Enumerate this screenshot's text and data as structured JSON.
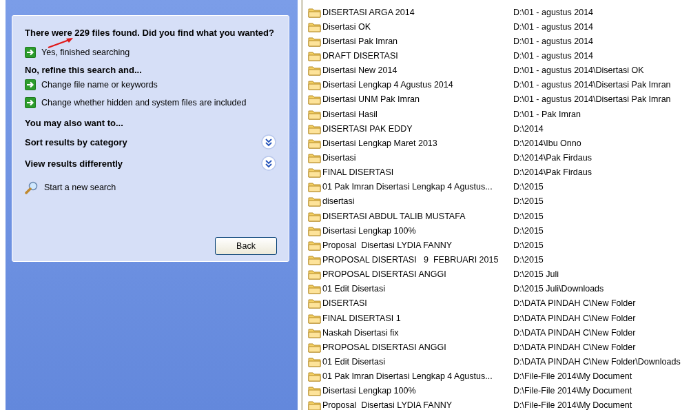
{
  "search_pane": {
    "question": "There were 229 files found. Did you find what you wanted?",
    "finish_link": "Yes, finished searching",
    "refine_heading": "No, refine this search and...",
    "refine_links": [
      "Change file name or keywords",
      "Change whether hidden and system files are included"
    ],
    "also_heading": "You may also want to...",
    "sections": [
      {
        "title": "Sort results by category",
        "expanded": false
      },
      {
        "title": "View results differently",
        "expanded": false
      }
    ],
    "new_search": "Start a new search",
    "back_button": "Back"
  },
  "results": [
    {
      "name": "DISERTASI ARGA 2014",
      "folder": "D:\\01 - agustus 2014"
    },
    {
      "name": "Disertasi OK",
      "folder": "D:\\01 - agustus 2014"
    },
    {
      "name": "Disertasi Pak Imran",
      "folder": "D:\\01 - agustus 2014"
    },
    {
      "name": "DRAFT DISERTASI",
      "folder": "D:\\01 - agustus 2014"
    },
    {
      "name": "Disertasi New 2014",
      "folder": "D:\\01 - agustus 2014\\Disertasi OK"
    },
    {
      "name": "Disertasi Lengkap 4 Agustus 2014",
      "folder": "D:\\01 - agustus 2014\\Disertasi Pak Imran"
    },
    {
      "name": "Disertasi UNM Pak Imran",
      "folder": "D:\\01 - agustus 2014\\Disertasi Pak Imran"
    },
    {
      "name": "Disertasi Hasil",
      "folder": "D:\\01 - Pak Imran"
    },
    {
      "name": "DISERTASI PAK EDDY",
      "folder": "D:\\2014"
    },
    {
      "name": "Disertasi Lengkap Maret 2013",
      "folder": "D:\\2014\\Ibu Onno"
    },
    {
      "name": "Disertasi",
      "folder": "D:\\2014\\Pak Firdaus"
    },
    {
      "name": "FINAL DISERTASI",
      "folder": "D:\\2014\\Pak Firdaus"
    },
    {
      "name": "01 Pak Imran Disertasi Lengkap 4 Agustus...",
      "folder": "D:\\2015"
    },
    {
      "name": "disertasi",
      "folder": "D:\\2015"
    },
    {
      "name": "DISERTASI ABDUL TALIB MUSTAFA",
      "folder": "D:\\2015"
    },
    {
      "name": "Disertasi Lengkap 100%",
      "folder": "D:\\2015"
    },
    {
      "name": "Proposal  Disertasi LYDIA FANNY",
      "folder": "D:\\2015"
    },
    {
      "name": "PROPOSAL DISERTASI   9  FEBRUARI 2015",
      "folder": "D:\\2015"
    },
    {
      "name": "PROPOSAL DISERTASI ANGGI",
      "folder": "D:\\2015 Juli"
    },
    {
      "name": "01 Edit Disertasi",
      "folder": "D:\\2015 Juli\\Downloads"
    },
    {
      "name": "DISERTASI",
      "folder": "D:\\DATA PINDAH C\\New Folder"
    },
    {
      "name": "FINAL DISERTASI 1",
      "folder": "D:\\DATA PINDAH C\\New Folder"
    },
    {
      "name": "Naskah Disertasi fix",
      "folder": "D:\\DATA PINDAH C\\New Folder"
    },
    {
      "name": "PROPOSAL DISERTASI ANGGI",
      "folder": "D:\\DATA PINDAH C\\New Folder"
    },
    {
      "name": "01 Edit Disertasi",
      "folder": "D:\\DATA PINDAH C\\New Folder\\Downloads"
    },
    {
      "name": "01 Pak Imran Disertasi Lengkap 4 Agustus...",
      "folder": "D:\\File-File 2014\\My Document"
    },
    {
      "name": "Disertasi Lengkap 100%",
      "folder": "D:\\File-File 2014\\My Document"
    },
    {
      "name": "Proposal  Disertasi LYDIA FANNY",
      "folder": "D:\\File-File 2014\\My Document"
    }
  ]
}
